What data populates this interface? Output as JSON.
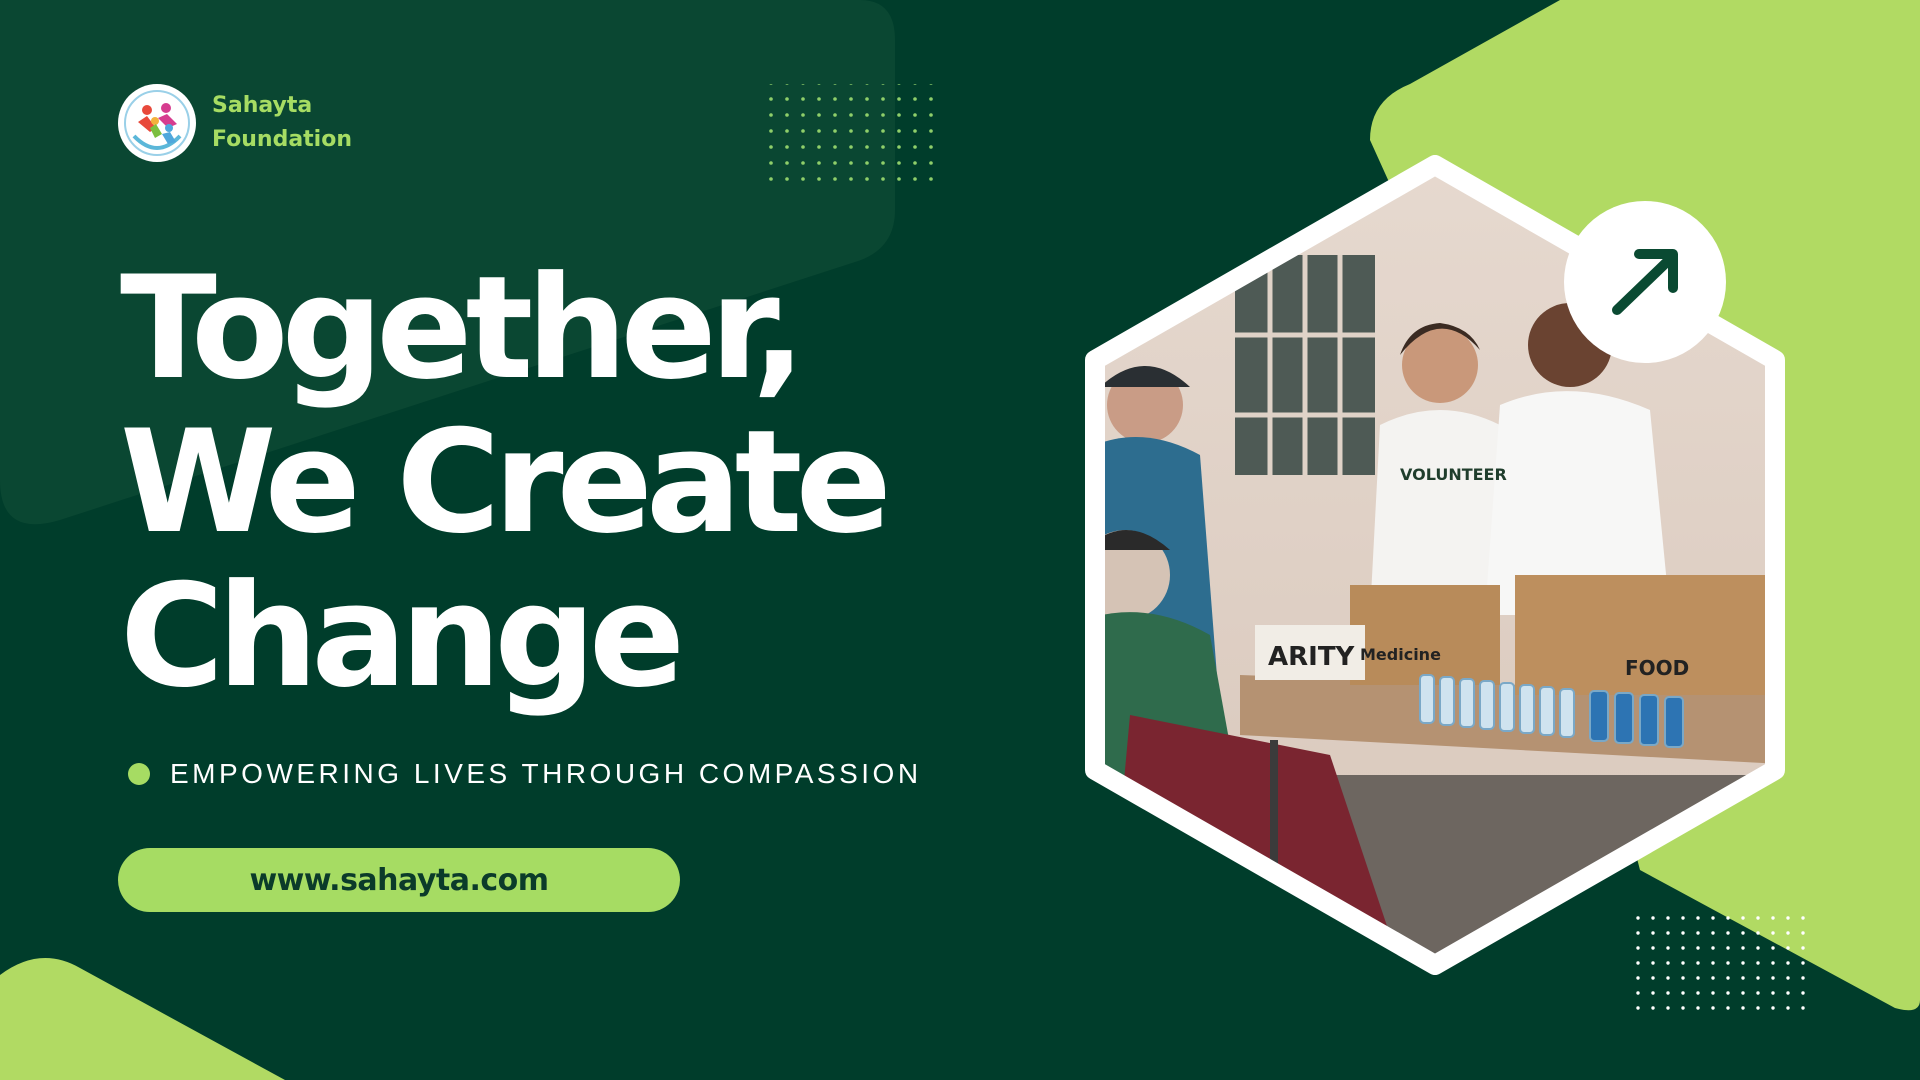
{
  "brand": {
    "line1": "Sahayta",
    "line2": "Foundation",
    "logo_icon": "people-circle-logo-icon"
  },
  "headline": {
    "line1": "Together,",
    "line2": "We Create",
    "line3": "Change"
  },
  "tagline": "EMPOWERING LIVES THROUGH COMPASSION",
  "website": "www.sahayta.com",
  "photo": {
    "sign_medicine": "Medicine",
    "sign_charity": "ARITY",
    "sign_food": "FOOD",
    "shirt_text": "VOLUNTEER"
  },
  "arrow_button": {
    "icon": "arrow-up-right-icon"
  },
  "colors": {
    "background": "#003d2b",
    "accent": "#a6dc63",
    "text": "#ffffff",
    "dark_text": "#0b3b2a"
  }
}
